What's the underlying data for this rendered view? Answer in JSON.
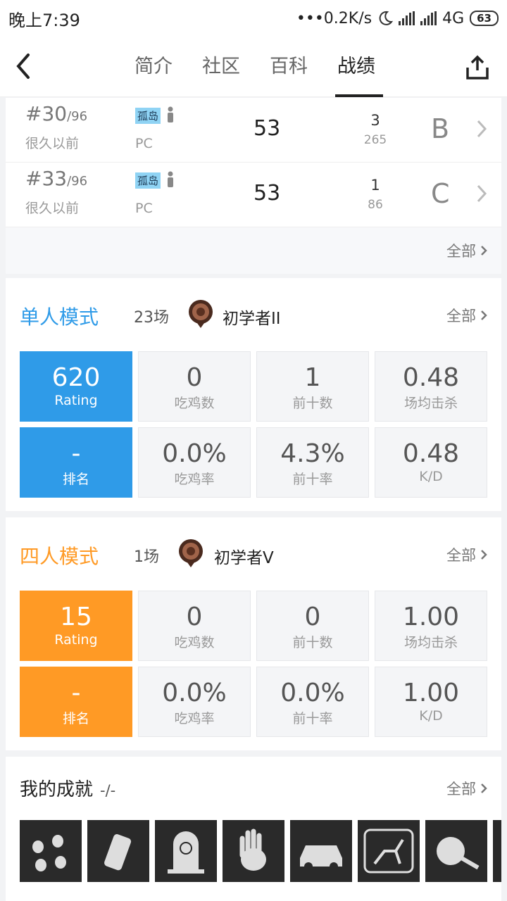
{
  "status_bar": {
    "time": "晚上7:39",
    "speed": "•••0.2K/s",
    "net": "4G",
    "battery": "63"
  },
  "nav": {
    "tabs": [
      "简介",
      "社区",
      "百科",
      "战绩"
    ],
    "active_tab": 3
  },
  "matches": [
    {
      "rank": "#30",
      "total": "/96",
      "when": "很久以前",
      "map": "孤岛",
      "platform": "PC",
      "score": "53",
      "kills": "3",
      "damage": "265",
      "grade": "B"
    },
    {
      "rank": "#33",
      "total": "/96",
      "when": "很久以前",
      "map": "孤岛",
      "platform": "PC",
      "score": "53",
      "kills": "1",
      "damage": "86",
      "grade": "C"
    }
  ],
  "all_label": "全部",
  "solo": {
    "title": "单人模式",
    "games": "23场",
    "tier": "初学者II",
    "color": "#2f9be8",
    "stats": [
      {
        "value": "620",
        "label": "Rating"
      },
      {
        "value": "0",
        "label": "吃鸡数"
      },
      {
        "value": "1",
        "label": "前十数"
      },
      {
        "value": "0.48",
        "label": "场均击杀"
      },
      {
        "value": "-",
        "label": "排名"
      },
      {
        "value": "0.0%",
        "label": "吃鸡率"
      },
      {
        "value": "4.3%",
        "label": "前十率"
      },
      {
        "value": "0.48",
        "label": "K/D"
      }
    ]
  },
  "squad": {
    "title": "四人模式",
    "games": "1场",
    "tier": "初学者V",
    "color": "#ff9a25",
    "stats": [
      {
        "value": "15",
        "label": "Rating"
      },
      {
        "value": "0",
        "label": "吃鸡数"
      },
      {
        "value": "0",
        "label": "前十数"
      },
      {
        "value": "1.00",
        "label": "场均击杀"
      },
      {
        "value": "-",
        "label": "排名"
      },
      {
        "value": "0.0%",
        "label": "吃鸡率"
      },
      {
        "value": "0.0%",
        "label": "前十率"
      },
      {
        "value": "1.00",
        "label": "K/D"
      }
    ]
  },
  "achievements": {
    "title": "我的成就",
    "count": "-/-",
    "icons": [
      "handprints-icon",
      "can-icon",
      "tombstone-icon",
      "bloody-hand-icon",
      "car-icon",
      "deer-sign-icon",
      "frying-pan-icon"
    ]
  }
}
